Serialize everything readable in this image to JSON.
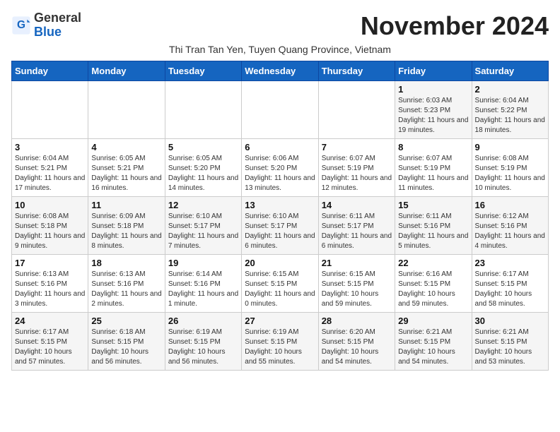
{
  "header": {
    "logo_general": "General",
    "logo_blue": "Blue",
    "month_title": "November 2024",
    "subtitle": "Thi Tran Tan Yen, Tuyen Quang Province, Vietnam"
  },
  "weekdays": [
    "Sunday",
    "Monday",
    "Tuesday",
    "Wednesday",
    "Thursday",
    "Friday",
    "Saturday"
  ],
  "weeks": [
    [
      {
        "day": "",
        "info": ""
      },
      {
        "day": "",
        "info": ""
      },
      {
        "day": "",
        "info": ""
      },
      {
        "day": "",
        "info": ""
      },
      {
        "day": "",
        "info": ""
      },
      {
        "day": "1",
        "info": "Sunrise: 6:03 AM\nSunset: 5:23 PM\nDaylight: 11 hours and 19 minutes."
      },
      {
        "day": "2",
        "info": "Sunrise: 6:04 AM\nSunset: 5:22 PM\nDaylight: 11 hours and 18 minutes."
      }
    ],
    [
      {
        "day": "3",
        "info": "Sunrise: 6:04 AM\nSunset: 5:21 PM\nDaylight: 11 hours and 17 minutes."
      },
      {
        "day": "4",
        "info": "Sunrise: 6:05 AM\nSunset: 5:21 PM\nDaylight: 11 hours and 16 minutes."
      },
      {
        "day": "5",
        "info": "Sunrise: 6:05 AM\nSunset: 5:20 PM\nDaylight: 11 hours and 14 minutes."
      },
      {
        "day": "6",
        "info": "Sunrise: 6:06 AM\nSunset: 5:20 PM\nDaylight: 11 hours and 13 minutes."
      },
      {
        "day": "7",
        "info": "Sunrise: 6:07 AM\nSunset: 5:19 PM\nDaylight: 11 hours and 12 minutes."
      },
      {
        "day": "8",
        "info": "Sunrise: 6:07 AM\nSunset: 5:19 PM\nDaylight: 11 hours and 11 minutes."
      },
      {
        "day": "9",
        "info": "Sunrise: 6:08 AM\nSunset: 5:19 PM\nDaylight: 11 hours and 10 minutes."
      }
    ],
    [
      {
        "day": "10",
        "info": "Sunrise: 6:08 AM\nSunset: 5:18 PM\nDaylight: 11 hours and 9 minutes."
      },
      {
        "day": "11",
        "info": "Sunrise: 6:09 AM\nSunset: 5:18 PM\nDaylight: 11 hours and 8 minutes."
      },
      {
        "day": "12",
        "info": "Sunrise: 6:10 AM\nSunset: 5:17 PM\nDaylight: 11 hours and 7 minutes."
      },
      {
        "day": "13",
        "info": "Sunrise: 6:10 AM\nSunset: 5:17 PM\nDaylight: 11 hours and 6 minutes."
      },
      {
        "day": "14",
        "info": "Sunrise: 6:11 AM\nSunset: 5:17 PM\nDaylight: 11 hours and 6 minutes."
      },
      {
        "day": "15",
        "info": "Sunrise: 6:11 AM\nSunset: 5:16 PM\nDaylight: 11 hours and 5 minutes."
      },
      {
        "day": "16",
        "info": "Sunrise: 6:12 AM\nSunset: 5:16 PM\nDaylight: 11 hours and 4 minutes."
      }
    ],
    [
      {
        "day": "17",
        "info": "Sunrise: 6:13 AM\nSunset: 5:16 PM\nDaylight: 11 hours and 3 minutes."
      },
      {
        "day": "18",
        "info": "Sunrise: 6:13 AM\nSunset: 5:16 PM\nDaylight: 11 hours and 2 minutes."
      },
      {
        "day": "19",
        "info": "Sunrise: 6:14 AM\nSunset: 5:16 PM\nDaylight: 11 hours and 1 minute."
      },
      {
        "day": "20",
        "info": "Sunrise: 6:15 AM\nSunset: 5:15 PM\nDaylight: 11 hours and 0 minutes."
      },
      {
        "day": "21",
        "info": "Sunrise: 6:15 AM\nSunset: 5:15 PM\nDaylight: 10 hours and 59 minutes."
      },
      {
        "day": "22",
        "info": "Sunrise: 6:16 AM\nSunset: 5:15 PM\nDaylight: 10 hours and 59 minutes."
      },
      {
        "day": "23",
        "info": "Sunrise: 6:17 AM\nSunset: 5:15 PM\nDaylight: 10 hours and 58 minutes."
      }
    ],
    [
      {
        "day": "24",
        "info": "Sunrise: 6:17 AM\nSunset: 5:15 PM\nDaylight: 10 hours and 57 minutes."
      },
      {
        "day": "25",
        "info": "Sunrise: 6:18 AM\nSunset: 5:15 PM\nDaylight: 10 hours and 56 minutes."
      },
      {
        "day": "26",
        "info": "Sunrise: 6:19 AM\nSunset: 5:15 PM\nDaylight: 10 hours and 56 minutes."
      },
      {
        "day": "27",
        "info": "Sunrise: 6:19 AM\nSunset: 5:15 PM\nDaylight: 10 hours and 55 minutes."
      },
      {
        "day": "28",
        "info": "Sunrise: 6:20 AM\nSunset: 5:15 PM\nDaylight: 10 hours and 54 minutes."
      },
      {
        "day": "29",
        "info": "Sunrise: 6:21 AM\nSunset: 5:15 PM\nDaylight: 10 hours and 54 minutes."
      },
      {
        "day": "30",
        "info": "Sunrise: 6:21 AM\nSunset: 5:15 PM\nDaylight: 10 hours and 53 minutes."
      }
    ]
  ]
}
